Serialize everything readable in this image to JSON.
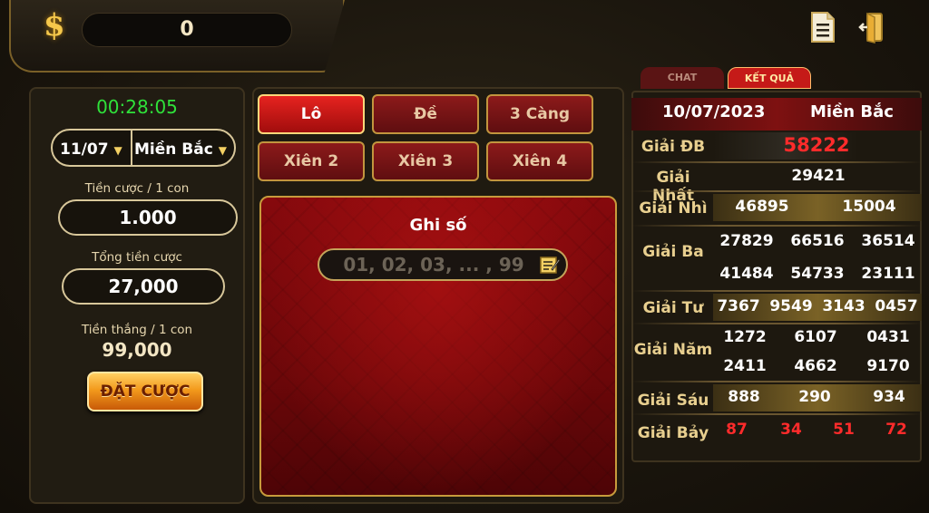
{
  "header": {
    "balance": "0",
    "icons": [
      "dollar-icon",
      "document-icon",
      "exit-door-icon"
    ],
    "dollar_symbol": "$"
  },
  "left": {
    "timer": "00:28:05",
    "date_select": "11/07",
    "region_select": "Miền Bắc",
    "bet_per_label": "Tiền cược / 1 con",
    "bet_per_value": "1.000",
    "total_label": "Tổng  tiền cược",
    "total_value": "27,000",
    "win_label": "Tiền thắng / 1 con",
    "win_value": "99,000",
    "bet_button": "ĐẶT CƯỢC"
  },
  "tabs": {
    "lo": "Lô",
    "de": "Đề",
    "ba_cang": "3 Càng",
    "xien2": "Xiên 2",
    "xien3": "Xiên 3",
    "xien4": "Xiên 4",
    "active": "Lô"
  },
  "board": {
    "title": "Ghi số",
    "placeholder": "01, 02, 03, ... , 99"
  },
  "results": {
    "tab_chat": "CHAT",
    "tab_result": "KẾT QUẢ",
    "date": "10/07/2023",
    "region": "Miền Bắc",
    "prizes": {
      "db": {
        "label": "Giải ĐB",
        "numbers": [
          "58222"
        ]
      },
      "nhat": {
        "label": "Giải Nhất",
        "numbers": [
          "29421"
        ]
      },
      "nhi": {
        "label": "Giải Nhì",
        "numbers": [
          "46895",
          "15004"
        ]
      },
      "ba": {
        "label": "Giải Ba",
        "numbers": [
          "27829",
          "66516",
          "36514",
          "41484",
          "54733",
          "23111"
        ]
      },
      "tu": {
        "label": "Giải Tư",
        "numbers": [
          "7367",
          "9549",
          "3143",
          "0457"
        ]
      },
      "nam": {
        "label": "Giải Năm",
        "numbers": [
          "1272",
          "6107",
          "0431",
          "2411",
          "4662",
          "9170"
        ]
      },
      "sau": {
        "label": "Giải Sáu",
        "numbers": [
          "888",
          "290",
          "934"
        ]
      },
      "bay": {
        "label": "Giải Bảy",
        "numbers": [
          "87",
          "34",
          "51",
          "72"
        ]
      }
    },
    "colors": {
      "highlight": "#ff2b2b",
      "gold": "#e8cf8f"
    }
  }
}
